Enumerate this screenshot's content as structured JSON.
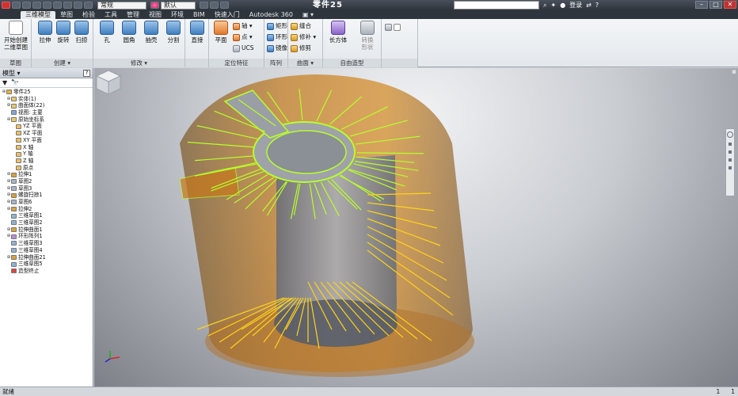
{
  "titlebar": {
    "style_select": "常规",
    "material_select": "默认",
    "document_title": "零件25",
    "user_label": "登录",
    "min": "–",
    "max": "□",
    "close": "✕"
  },
  "tabs": [
    "三维模型",
    "草图",
    "检验",
    "工具",
    "管理",
    "视图",
    "环境",
    "BIM",
    "快速入门",
    "Autodesk 360"
  ],
  "tabs_extra": "▣ ▾",
  "ribbon": {
    "sketch": {
      "start_label": "开始创建",
      "start_label2": "二维草图",
      "panel": "草图"
    },
    "create": {
      "extrude": "拉伸",
      "revolve": "旋转",
      "sweep": "扫掠",
      "panel": "创建 ▾"
    },
    "modify": {
      "hole": "孔",
      "fillet": "圆角",
      "shell": "抽壳",
      "split": "分割",
      "panel": "修改 ▾"
    },
    "direct": {
      "label": "直接"
    },
    "workfeatures": {
      "plane": "平面",
      "axis": "轴 ▾",
      "point": "点 ▾",
      "ucs": "UCS",
      "panel": "定位特征"
    },
    "pattern": {
      "rect": "矩形",
      "circ": "环形",
      "mirror": "镜像",
      "panel": "阵列"
    },
    "surface": {
      "stitch": "缝合",
      "patch": "修补 ▾",
      "trim": "修剪",
      "panel": "曲面 ▾"
    },
    "freeform": {
      "box": "长方体",
      "convert": "转换",
      "convert2": "形状",
      "panel": "自由造型"
    }
  },
  "browser": {
    "title": "模型 ▾",
    "help": "?",
    "items": [
      {
        "label": "零件25",
        "level": 0,
        "icon": "part"
      },
      {
        "label": "实体(1)",
        "level": 1,
        "icon": "folder"
      },
      {
        "label": "曲面体(22)",
        "level": 1,
        "icon": "folder"
      },
      {
        "label": "视图: 主要",
        "level": 1,
        "icon": "view"
      },
      {
        "label": "原始坐标系",
        "level": 1,
        "icon": "folder"
      },
      {
        "label": "YZ 平面",
        "level": 2,
        "icon": "plane"
      },
      {
        "label": "XZ 平面",
        "level": 2,
        "icon": "plane"
      },
      {
        "label": "XY 平面",
        "level": 2,
        "icon": "plane"
      },
      {
        "label": "X 轴",
        "level": 2,
        "icon": "axis"
      },
      {
        "label": "Y 轴",
        "level": 2,
        "icon": "axis"
      },
      {
        "label": "Z 轴",
        "level": 2,
        "icon": "axis"
      },
      {
        "label": "原点",
        "level": 2,
        "icon": "point"
      },
      {
        "label": "拉伸1",
        "level": 1,
        "icon": "feature"
      },
      {
        "label": "草图2",
        "level": 1,
        "icon": "sketch"
      },
      {
        "label": "草图3",
        "level": 1,
        "icon": "sketch"
      },
      {
        "label": "螺旋扫掠1",
        "level": 1,
        "icon": "feature"
      },
      {
        "label": "草图6",
        "level": 1,
        "icon": "sketch"
      },
      {
        "label": "拉伸2",
        "level": 1,
        "icon": "feature"
      },
      {
        "label": "三维草图1",
        "level": 1,
        "icon": "sketch3d"
      },
      {
        "label": "三维草图2",
        "level": 1,
        "icon": "sketch3d"
      },
      {
        "label": "拉伸曲面1",
        "level": 1,
        "icon": "surface"
      },
      {
        "label": "环形阵列1",
        "level": 1,
        "icon": "pattern"
      },
      {
        "label": "三维草图3",
        "level": 1,
        "icon": "sketch3d"
      },
      {
        "label": "三维草图4",
        "level": 1,
        "icon": "sketch3d"
      },
      {
        "label": "拉伸曲面21",
        "level": 1,
        "icon": "surface"
      },
      {
        "label": "三维草图5",
        "level": 1,
        "icon": "sketch3d"
      },
      {
        "label": "造型终止",
        "level": 1,
        "icon": "end"
      }
    ]
  },
  "status": {
    "text": "就绪",
    "n1": "1",
    "n2": "1"
  },
  "colors": {
    "body_orange": "#c8781a",
    "core_gray": "#8a8d96",
    "edge_green": "#b6ff2a",
    "edge_yellow": "#ffd21a"
  }
}
